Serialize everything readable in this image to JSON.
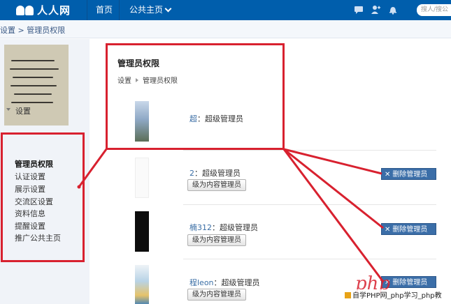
{
  "topbar": {
    "logo_text": "人人网",
    "nav": [
      {
        "label": "首页"
      },
      {
        "label": "公共主页"
      }
    ],
    "icons": [
      "chat-icon",
      "friend-request-icon",
      "notification-bell-icon"
    ],
    "search_placeholder": "搜人/搜公"
  },
  "breadcrumb": {
    "text": "设置 > 管理员权限"
  },
  "sidebar": {
    "section": "设置",
    "items": [
      {
        "label": "管理员权限",
        "active": true
      },
      {
        "label": "认证设置"
      },
      {
        "label": "展示设置"
      },
      {
        "label": "交流区设置"
      },
      {
        "label": "资料信息"
      },
      {
        "label": "提醒设置"
      },
      {
        "label": "推广公共主页"
      }
    ]
  },
  "panel": {
    "title": "管理员权限",
    "crumb_root": "设置",
    "crumb_current": "管理员权限"
  },
  "members": [
    {
      "name": "超",
      "role_label": "：超级管理员"
    },
    {
      "name": "2",
      "role_label": "：超级管理员",
      "demote_button": "级为内容管理员",
      "remove_button": "删除管理员"
    },
    {
      "name": "楠312",
      "role_label": "：超级管理员",
      "demote_button": "级为内容管理员",
      "remove_button": "删除管理员"
    },
    {
      "name": "程leon",
      "role_label": "：超级管理员",
      "demote_button": "级为内容管理员",
      "remove_button": "删除管理员"
    }
  ],
  "colors": {
    "topbar": "#005eac",
    "annotation": "#d8212f",
    "remove_button": "#3b6ea8"
  },
  "watermark": {
    "logo": "php",
    "text": "自学PHP网_php学习_php教"
  }
}
